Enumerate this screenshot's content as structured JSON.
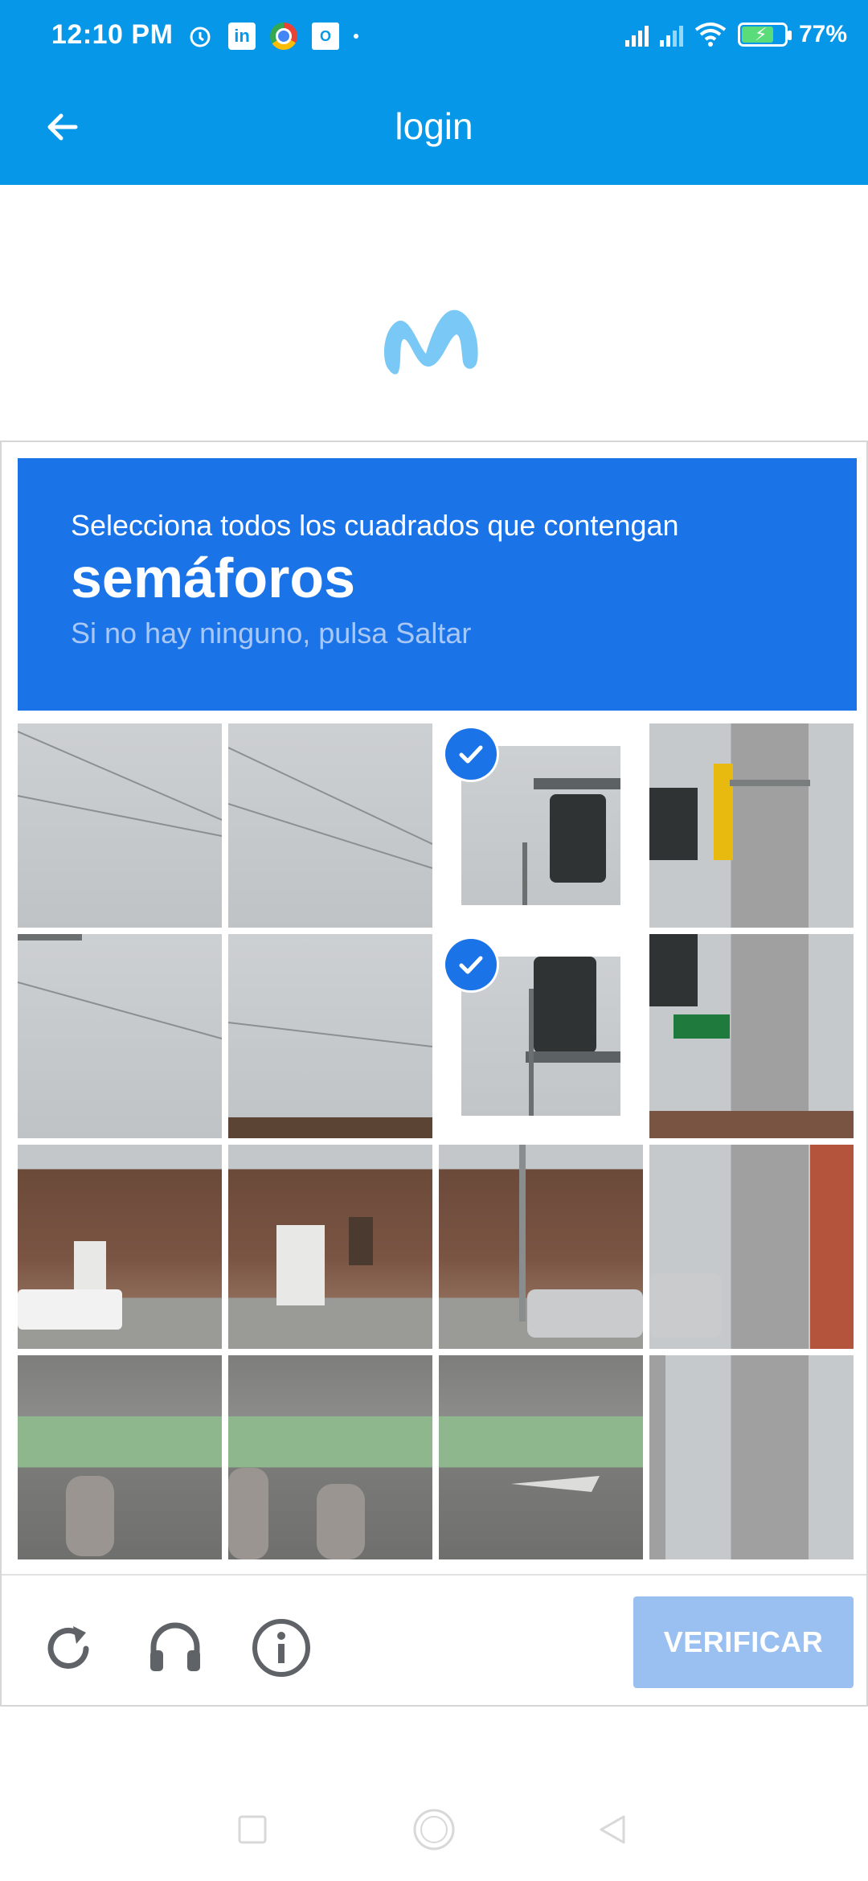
{
  "status_bar": {
    "time": "12:10 PM",
    "battery_percent": "77%",
    "icons": [
      "alarm-icon",
      "linkedin-icon",
      "chrome-icon",
      "outlook-icon",
      "signal-icon",
      "signal-icon",
      "wifi-icon",
      "battery-charging-icon"
    ]
  },
  "app_bar": {
    "title": "login",
    "back_icon": "arrow-left-icon"
  },
  "brand": {
    "logo": "movistar-m-logo",
    "color": "#79c8f5"
  },
  "captcha": {
    "instruction": "Selecciona todos los cuadrados que contengan",
    "keyword": "semáforos",
    "hint": "Si no hay ninguno, pulsa Saltar",
    "grid_rows": 4,
    "grid_cols": 4,
    "selected_tiles": [
      [
        0,
        2
      ],
      [
        1,
        2
      ]
    ],
    "verify_label": "VERIFICAR",
    "footer_icons": [
      "reload-icon",
      "headphones-icon",
      "info-icon"
    ],
    "accent_color": "#1b73e8"
  },
  "nav_bar": {
    "icons": [
      "square-icon",
      "circle-icon",
      "triangle-back-icon"
    ]
  }
}
